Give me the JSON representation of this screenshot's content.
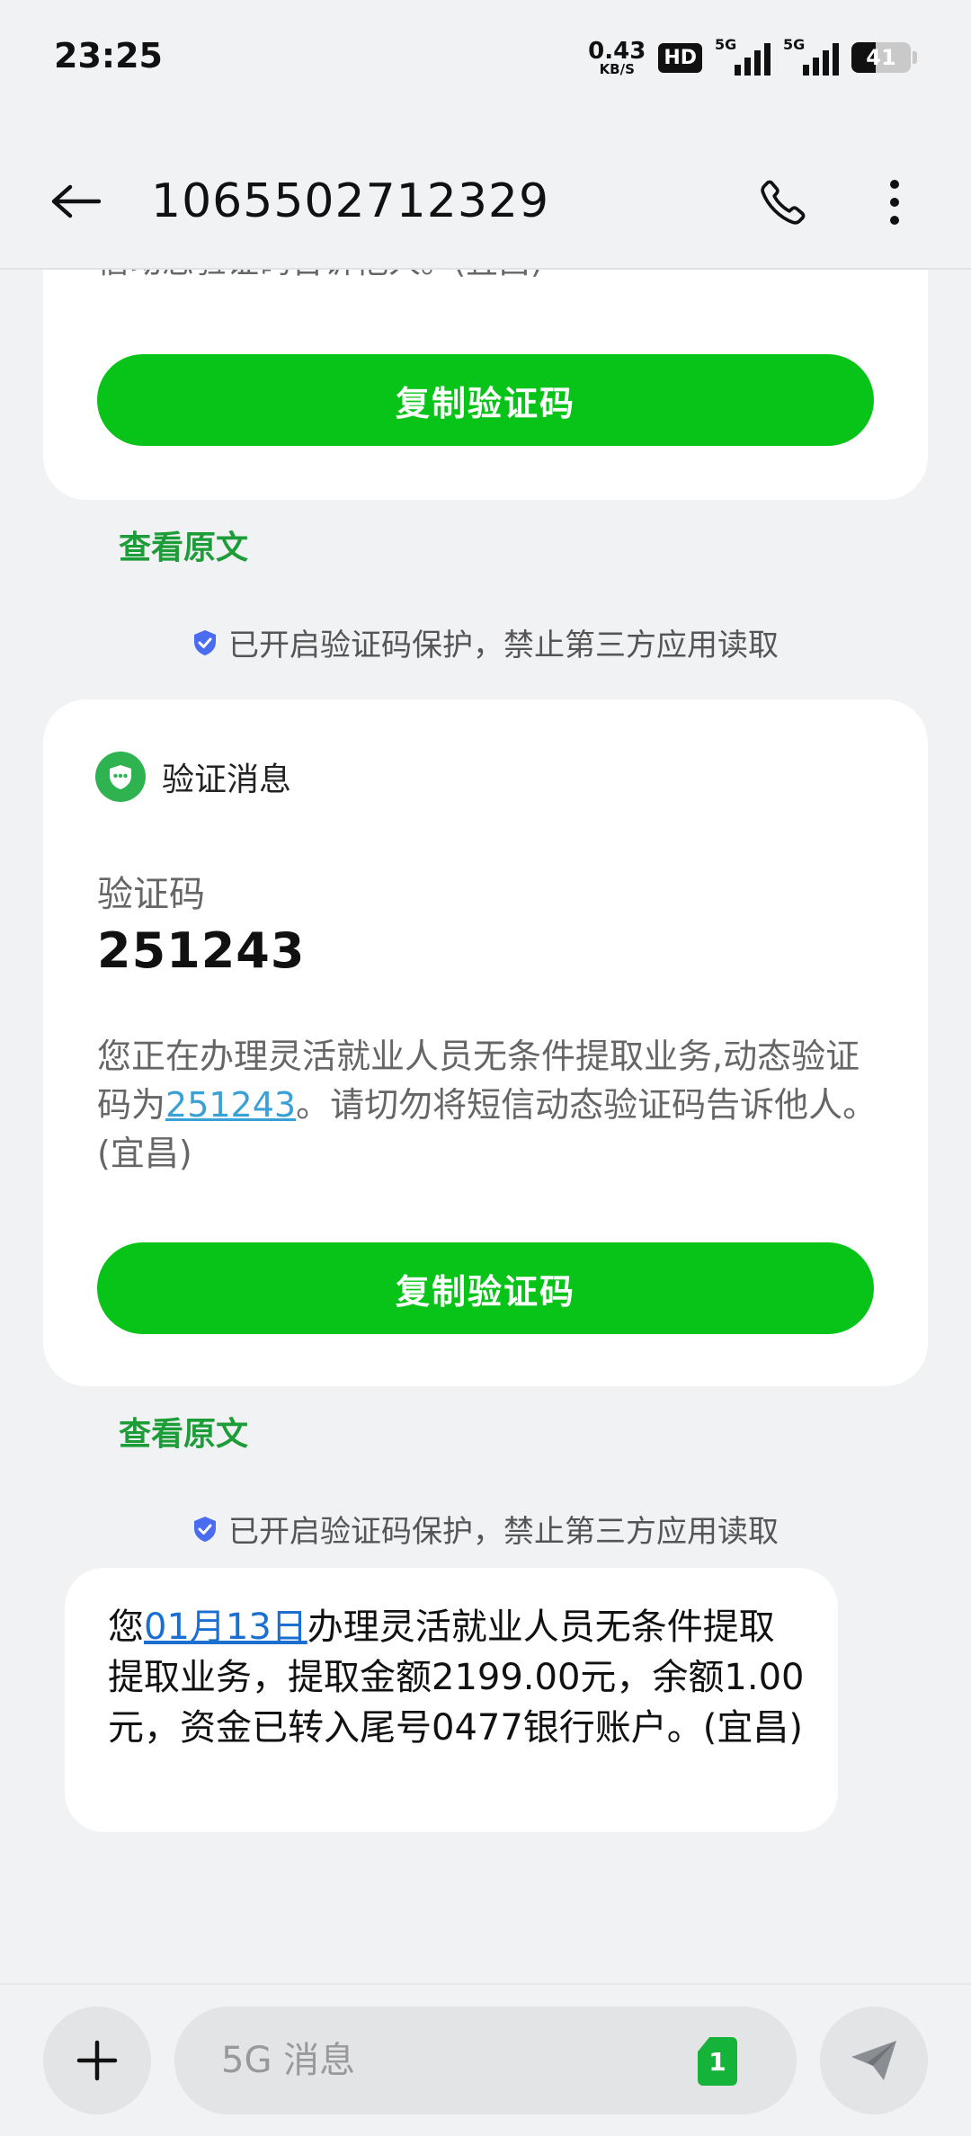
{
  "status_bar": {
    "time": "23:25",
    "net_speed_value": "0.43",
    "net_speed_unit": "KB/S",
    "hd": "HD",
    "signal1_label": "5G",
    "signal2_label": "5G",
    "battery": "41",
    "battery_level": 0.41
  },
  "header": {
    "title": "1065502712329"
  },
  "thread": {
    "card_top_partial_text": "信动态验证码告诉他人。(宜昌)",
    "copy_button_label": "复制验证码",
    "view_original_label": "查看原文",
    "protection_notice": "已开启验证码保护，禁止第三方应用读取",
    "verify_card": {
      "header_label": "验证消息",
      "code_label": "验证码",
      "code_value": "251243",
      "body_before": "您正在办理灵活就业人员无条件提取业务,动态验证码为",
      "body_code": "251243",
      "body_after": "。请切勿将短信动态验证码告诉他人。(宜昌)",
      "copy_button_label": "复制验证码"
    },
    "last_message": {
      "before": "您",
      "date_link": "01月13日",
      "after": "办理灵活就业人员无条件提取提取业务，提取金额2199.00元，余额1.00元，资金已转入尾号0477银行账户。(宜昌)"
    }
  },
  "composer": {
    "placeholder": "5G 消息",
    "sim_slot": "1"
  },
  "colors": {
    "accent_green": "#08c318",
    "link_blue": "#1b6fd1",
    "code_link": "#3aa0d8",
    "background": "#f1f2f4"
  }
}
